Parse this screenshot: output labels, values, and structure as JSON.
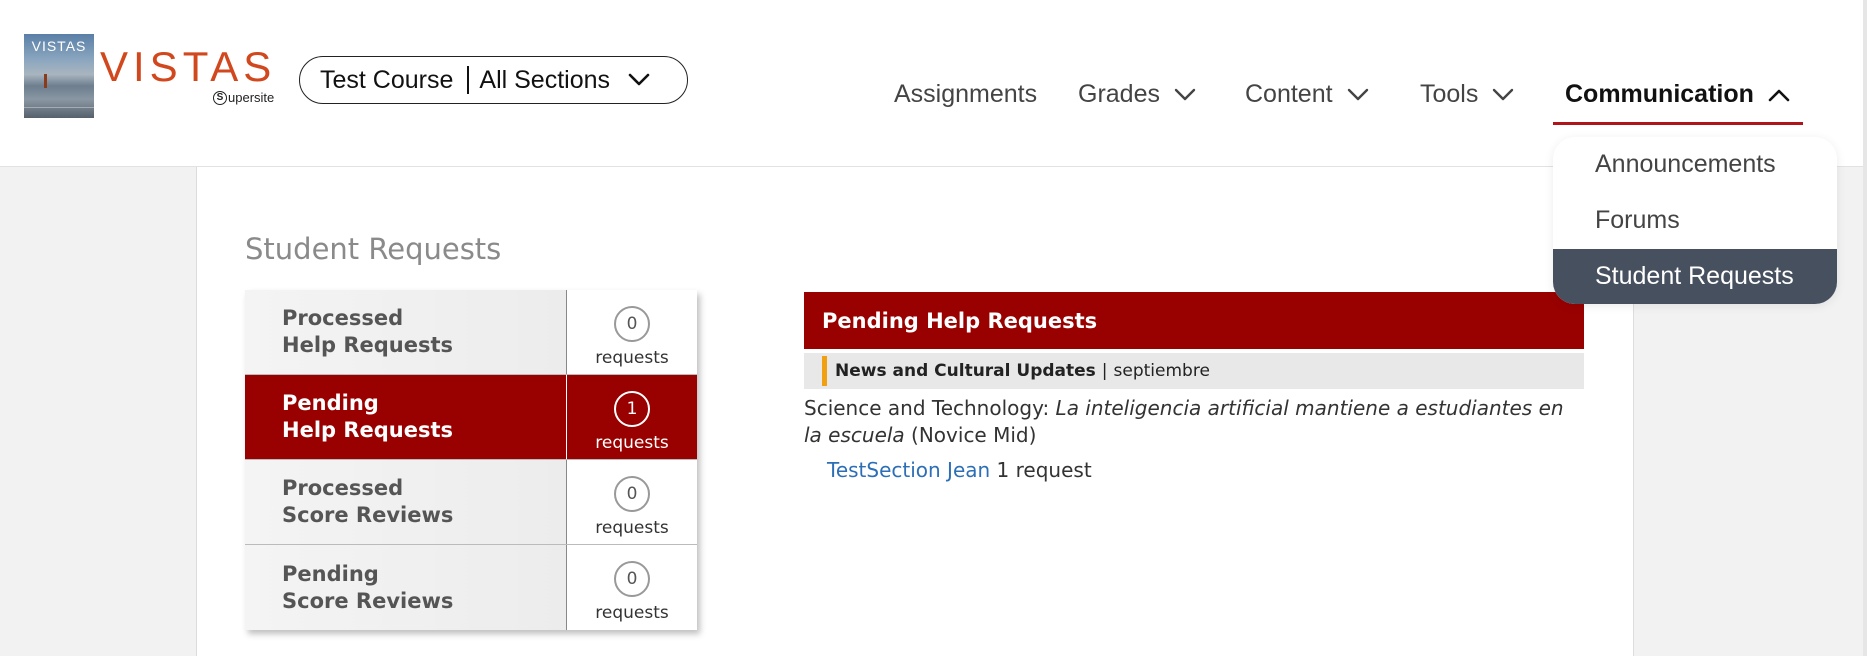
{
  "header": {
    "logo": {
      "small_text": "VISTAS",
      "big_text": "VISTAS",
      "sub_text": "upersite",
      "sub_badge": "S"
    },
    "course_select": {
      "course": "Test Course",
      "section": "All Sections",
      "icon": "chevron-down-icon"
    },
    "nav": [
      {
        "label": "Assignments",
        "has_chevron": false,
        "active": false
      },
      {
        "label": "Grades",
        "has_chevron": true,
        "active": false
      },
      {
        "label": "Content",
        "has_chevron": true,
        "active": false
      },
      {
        "label": "Tools",
        "has_chevron": true,
        "active": false
      },
      {
        "label": "Communication",
        "has_chevron": true,
        "active": true,
        "expanded": true
      }
    ],
    "dropdown": [
      {
        "label": "Announcements",
        "active": false
      },
      {
        "label": "Forums",
        "active": false
      },
      {
        "label": "Student Requests",
        "active": true
      }
    ]
  },
  "main": {
    "title": "Student Requests",
    "request_rows": [
      {
        "line1": "Processed",
        "line2": "Help Requests",
        "count": "0",
        "unit": "requests",
        "active": false
      },
      {
        "line1": "Pending",
        "line2": "Help Requests",
        "count": "1",
        "unit": "requests",
        "active": true
      },
      {
        "line1": "Processed",
        "line2": "Score Reviews",
        "count": "0",
        "unit": "requests",
        "active": false
      },
      {
        "line1": "Pending",
        "line2": "Score Reviews",
        "count": "0",
        "unit": "requests",
        "active": false
      }
    ],
    "pending_panel": {
      "header": "Pending Help Requests",
      "category": "News and Cultural Updates",
      "separator": "|",
      "month": "septiembre",
      "topic_prefix": "Science and Technology:",
      "topic_title": "La inteligencia artificial mantiene a estudiantes en la escuela",
      "level": "(Novice Mid)",
      "student_name": "TestSection Jean",
      "student_count": "1",
      "student_count_unit": "request"
    }
  },
  "colors": {
    "brand_red": "#990000",
    "logo_orange": "#d2481e",
    "nav_underline": "#b0151a",
    "dropdown_active": "#46505f",
    "link_blue": "#2d6fb6",
    "accent_orange": "#f0a010"
  }
}
